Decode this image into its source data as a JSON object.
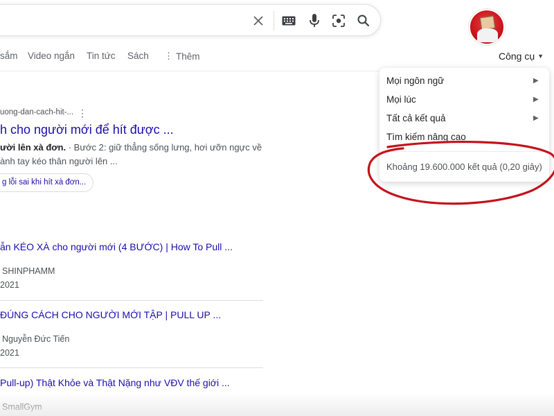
{
  "tabs": {
    "items": [
      {
        "label": "sắm"
      },
      {
        "label": "Video ngắn"
      },
      {
        "label": "Tin tức"
      },
      {
        "label": "Sách"
      },
      {
        "label": "Thêm"
      }
    ],
    "tools_label": "Công cụ"
  },
  "dropdown": {
    "items": [
      {
        "label": "Mọi ngôn ngữ"
      },
      {
        "label": "Mọi lúc"
      },
      {
        "label": "Tất cả kết quả"
      },
      {
        "label": "Tìm kiếm nâng cao"
      }
    ],
    "stats": "Khoảng 19.600.000 kết quả (0,20 giây)"
  },
  "result1": {
    "url": "uong-dan-cach-hit-...",
    "title": "h cho người mới để hít được ...",
    "snippet_bold": "ười lên xà đơn.",
    "snippet_rest": " · Bước 2: giữ thẳng sống lưng, hơi ưỡn ngực về",
    "snippet_line2": "ành tay kéo thân người lên ...",
    "chip": "g lỗi sai khi hít xà đơn..."
  },
  "videos": [
    {
      "title": "ẫn KÉO XÀ cho người mới (4 BƯỚC) | How To Pull ...",
      "channel": "SHINPHAMM",
      "year": "2021"
    },
    {
      "title": "ĐÚNG CÁCH CHO NGƯỜI MỚI TẬP | PULL UP ...",
      "channel": "Nguyễn Đức Tiến",
      "year": "2021"
    },
    {
      "title": "Pull-up) Thật Khỏe và Thật Nặng như VĐV thế giới ...",
      "channel": "SmallGym",
      "year": ""
    }
  ],
  "colors": {
    "link": "#1a0dab",
    "annotation": "#c4121b",
    "avatar": "#c9151b"
  },
  "icons": [
    "close-icon",
    "keyboard-icon",
    "mic-icon",
    "lens-icon",
    "search-icon",
    "caret-right-icon"
  ]
}
